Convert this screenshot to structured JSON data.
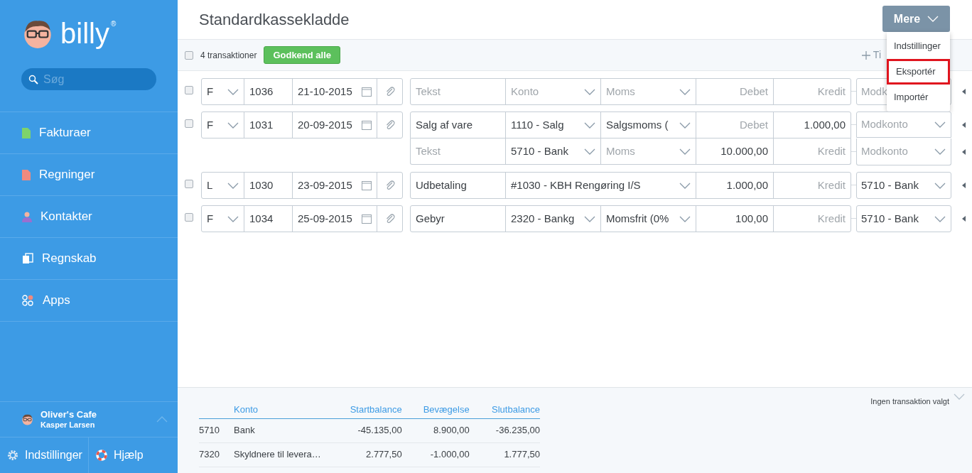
{
  "sidebar": {
    "logo": "billy",
    "logo_mark": "®",
    "search": {
      "placeholder": "Søg"
    },
    "items": [
      {
        "label": "Fakturaer",
        "kind": "invoice",
        "selected": false
      },
      {
        "label": "Regninger",
        "kind": "bill",
        "selected": false
      },
      {
        "label": "Kontakter",
        "kind": "contact",
        "selected": false
      },
      {
        "label": "Regnskab",
        "kind": "ledger",
        "selected": false
      },
      {
        "label": "Apps",
        "kind": "apps",
        "selected": false
      }
    ],
    "organization": {
      "name": "Oliver's Cafe",
      "user": "Kasper Larsen"
    },
    "footer": [
      {
        "label": "Indstillinger",
        "kind": "settings"
      },
      {
        "label": "Hjælp",
        "kind": "help"
      }
    ]
  },
  "header": {
    "title": "Standardkassekladde",
    "more_button": "Mere"
  },
  "menu": [
    {
      "label": "Indstillinger",
      "highlighted": false
    },
    {
      "label": "Eksportér",
      "highlighted": true
    },
    {
      "label": "Importér",
      "highlighted": false
    }
  ],
  "toolbar": {
    "select_all": false,
    "count": "4 transaktioner",
    "approve_button": "Godkend alle",
    "add_button": "Ti"
  },
  "transactions": [
    {
      "checked": false,
      "type": "F",
      "number": "1036",
      "date": "21-10-2015",
      "lines": [
        {
          "text": {
            "placeholder": "Tekst"
          },
          "account": {
            "placeholder": "Konto"
          },
          "vat": {
            "placeholder": "Moms"
          },
          "debit": {
            "placeholder": "Debet"
          },
          "credit": {
            "placeholder": "Kredit"
          },
          "counter": {
            "placeholder": "Modk",
            "covered": true
          }
        }
      ]
    },
    {
      "checked": false,
      "type": "F",
      "number": "1031",
      "date": "20-09-2015",
      "lines": [
        {
          "text": {
            "value": "Salg af vare"
          },
          "account": {
            "value": "1110 - Salg"
          },
          "vat": {
            "value": "Salgsmoms ("
          },
          "debit": {
            "placeholder": "Debet"
          },
          "credit": {
            "value": "1.000,00"
          },
          "counter": {
            "placeholder": "Modkonto",
            "covered": false
          }
        },
        {
          "text": {
            "placeholder": "Tekst"
          },
          "account": {
            "value": "5710 - Bank"
          },
          "vat": {
            "placeholder": "Moms"
          },
          "debit": {
            "value": "10.000,00"
          },
          "credit": {
            "placeholder": "Kredit"
          },
          "counter": {
            "placeholder": "Modkonto",
            "covered": false
          }
        }
      ]
    },
    {
      "checked": false,
      "type": "L",
      "number": "1030",
      "date": "23-09-2015",
      "lines": [
        {
          "text": {
            "value": "Udbetaling"
          },
          "account": {
            "value": "#1030 - KBH Rengøring I/S"
          },
          "debit": {
            "value": "1.000,00"
          },
          "credit": {
            "placeholder": "Kredit"
          },
          "counter": {
            "value": "5710 - Bank",
            "covered": false
          }
        }
      ]
    },
    {
      "checked": false,
      "type": "F",
      "number": "1034",
      "date": "25-09-2015",
      "lines": [
        {
          "text": {
            "value": "Gebyr"
          },
          "account": {
            "value": "2320 - Bankg"
          },
          "vat": {
            "value": "Momsfrit (0%"
          },
          "debit": {
            "value": "100,00"
          },
          "credit": {
            "placeholder": "Kredit"
          },
          "counter": {
            "value": "5710 - Bank",
            "covered": false
          }
        }
      ]
    }
  ],
  "balance": {
    "status": "Ingen transaktion valgt",
    "columns": [
      "Konto",
      "Startbalance",
      "Bevægelse",
      "Slutbalance"
    ],
    "rows": [
      {
        "number": "5710",
        "name": "Bank",
        "start": "-45.135,00",
        "movement": "8.900,00",
        "end": "-36.235,00"
      },
      {
        "number": "7320",
        "name": "Skyldnere til levera…",
        "start": "2.777,50",
        "movement": "-1.000,00",
        "end": "1.777,50"
      }
    ]
  }
}
